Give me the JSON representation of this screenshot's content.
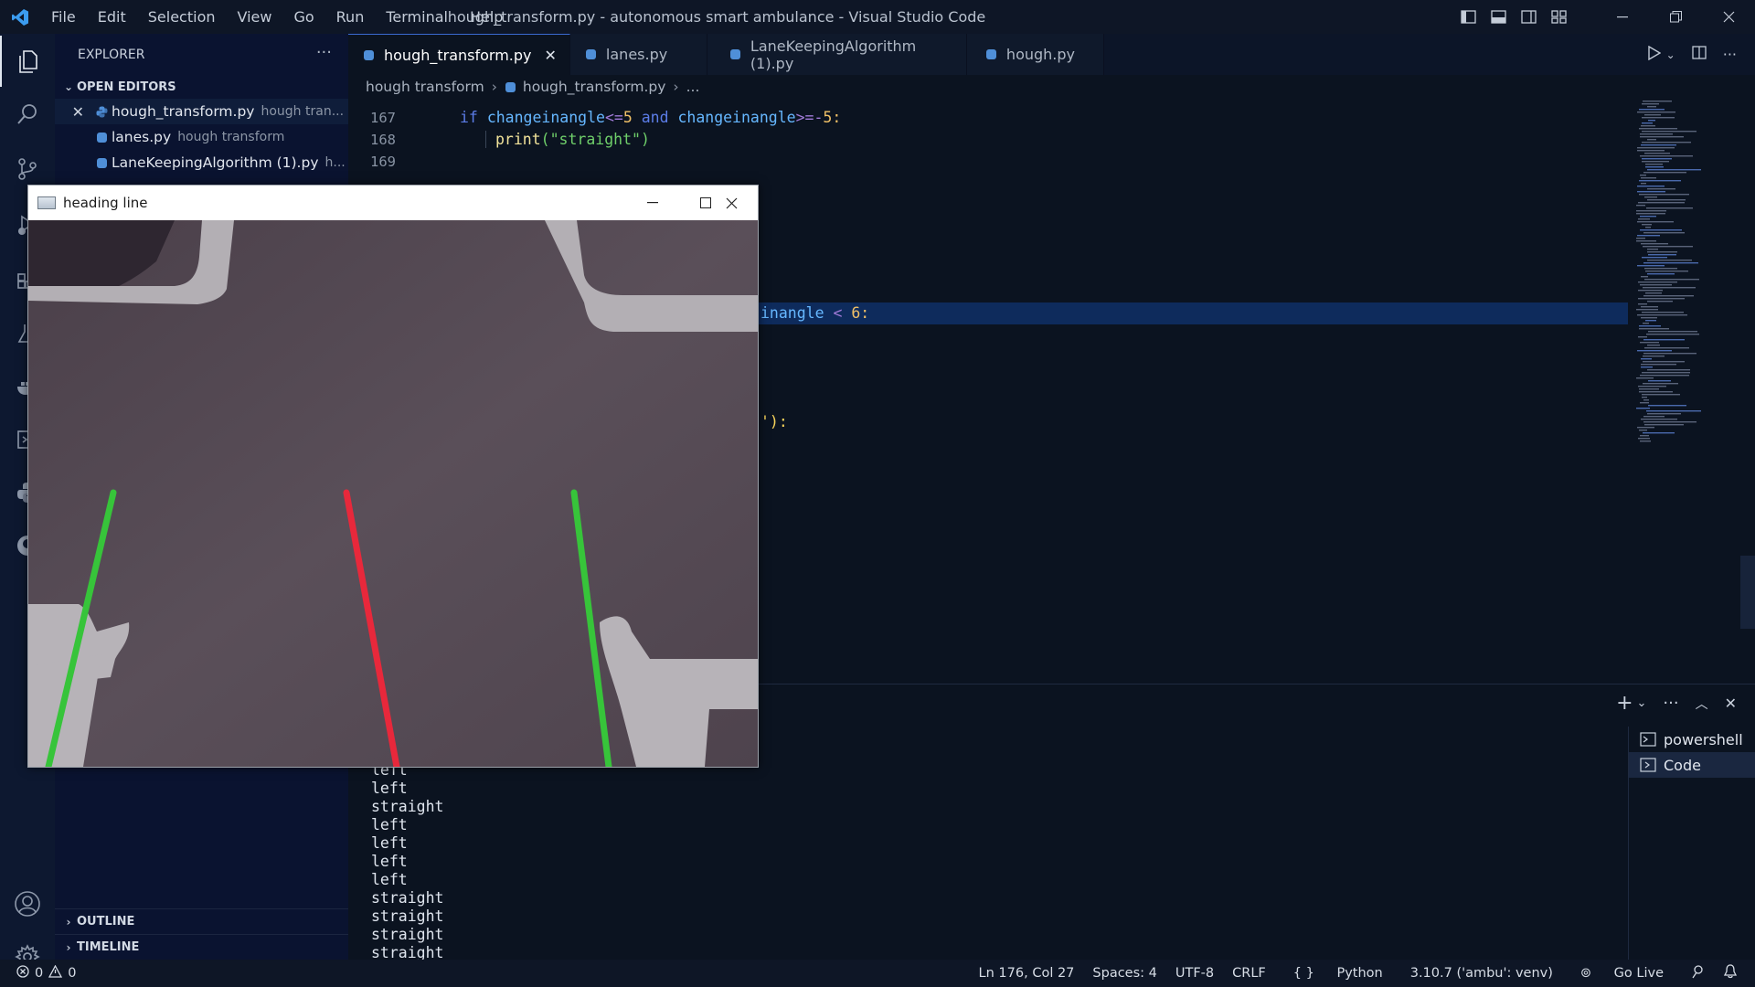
{
  "titlebar": {
    "menu": [
      "File",
      "Edit",
      "Selection",
      "View",
      "Go",
      "Run",
      "Terminal",
      "Help"
    ],
    "title": "hough_transform.py - autonomous smart ambulance - Visual Studio Code"
  },
  "activity": [
    "explorer-icon",
    "search-icon",
    "source-control-icon",
    "run-debug-icon",
    "extensions-icon",
    "testing-icon",
    "docker-icon",
    "remote-explorer-icon",
    "python-icon",
    "github-icon",
    "account-icon",
    "gear-icon"
  ],
  "sidebar": {
    "header": "EXPLORER",
    "open_editors_label": "OPEN EDITORS",
    "open_editors": [
      {
        "name": "hough_transform.py",
        "desc": "hough tran..."
      },
      {
        "name": "lanes.py",
        "desc": "hough transform"
      },
      {
        "name": "LaneKeepingAlgorithm (1).py",
        "desc": "h..."
      }
    ],
    "outline": "OUTLINE",
    "timeline": "TIMELINE"
  },
  "tabs": [
    "hough_transform.py",
    "lanes.py",
    "LaneKeepingAlgorithm (1).py",
    "hough.py"
  ],
  "breadcrumb": [
    "hough transform",
    "hough_transform.py",
    "..."
  ],
  "editor": {
    "line_numbers": [
      "167",
      "168",
      "169"
    ],
    "line167": {
      "kw1": "if",
      "v1": "changeinangle",
      "op1": "<=",
      "n1": "5",
      "kw2": "and",
      "v2": "changeinangle",
      "op2": ">=-",
      "n2": "5",
      "end": ":"
    },
    "line168": {
      "fn": "print",
      "arg": "(\"straight\")"
    },
    "visible_fragment_1": "inangle",
    "visible_fragment_1_op": "<",
    "visible_fragment_1_num": "6",
    "visible_fragment_1_end": ":",
    "visible_fragment_2": "'):"
  },
  "terminal": {
    "output": [
      "left",
      "left",
      "straight",
      "left",
      "left",
      "left",
      "left",
      "straight",
      "straight",
      "straight",
      "straight"
    ],
    "sessions": [
      "powershell",
      "Code"
    ]
  },
  "status": {
    "errors": "0",
    "warnings": "0",
    "position": "Ln 176, Col 27",
    "spaces": "Spaces: 4",
    "encoding": "UTF-8",
    "eol": "CRLF",
    "language": "Python",
    "interpreter": "3.10.7 ('ambu': venv)",
    "golive": "Go Live"
  },
  "cv_window": {
    "title": "heading line",
    "lines": [
      {
        "color": "#37c43a",
        "role": "left lane"
      },
      {
        "color": "#e8283b",
        "role": "heading line"
      },
      {
        "color": "#37c43a",
        "role": "right lane"
      }
    ]
  }
}
